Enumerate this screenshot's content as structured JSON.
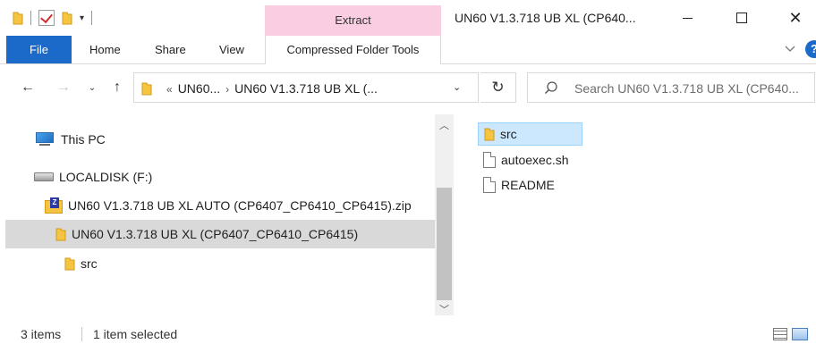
{
  "window": {
    "title": "UN60 V1.3.718 UB XL (CP640...",
    "close_glyph": "✕"
  },
  "ribbon": {
    "contextual_header": "Extract",
    "tabs": [
      "File",
      "Home",
      "Share",
      "View",
      "Compressed Folder Tools"
    ],
    "help_glyph": "?"
  },
  "navigation": {
    "back_glyph": "←",
    "forward_glyph": "→",
    "recent_glyph": "⌄",
    "up_glyph": "↑",
    "refresh_glyph": "↻"
  },
  "address": {
    "overflow": "«",
    "crumbs": [
      "UN60...",
      "UN60 V1.3.718 UB XL (..."
    ],
    "separator": "›"
  },
  "search": {
    "placeholder": "Search UN60 V1.3.718 UB XL (CP640..."
  },
  "tree": {
    "items": [
      {
        "label": "This PC",
        "icon": "computer-icon"
      },
      {
        "label": "LOCALDISK (F:)",
        "icon": "drive-icon"
      },
      {
        "label": "UN60 V1.3.718 UB XL AUTO (CP6407_CP6410_CP6415).zip",
        "icon": "zip-folder-icon"
      },
      {
        "label": "UN60 V1.3.718 UB XL (CP6407_CP6410_CP6415)",
        "icon": "folder-icon",
        "selected": true
      },
      {
        "label": "src",
        "icon": "folder-icon"
      }
    ]
  },
  "files": [
    {
      "name": "src",
      "icon": "folder-icon",
      "selected": true
    },
    {
      "name": "autoexec.sh",
      "icon": "file-icon"
    },
    {
      "name": "README",
      "icon": "file-icon"
    }
  ],
  "status": {
    "item_count": "3 items",
    "selection": "1 item selected"
  },
  "colors": {
    "accent": "#1b6ac9",
    "contextual_tab": "#fbcde2",
    "selection_blue": "#cce8ff",
    "tree_selection": "#d9d9d9"
  }
}
